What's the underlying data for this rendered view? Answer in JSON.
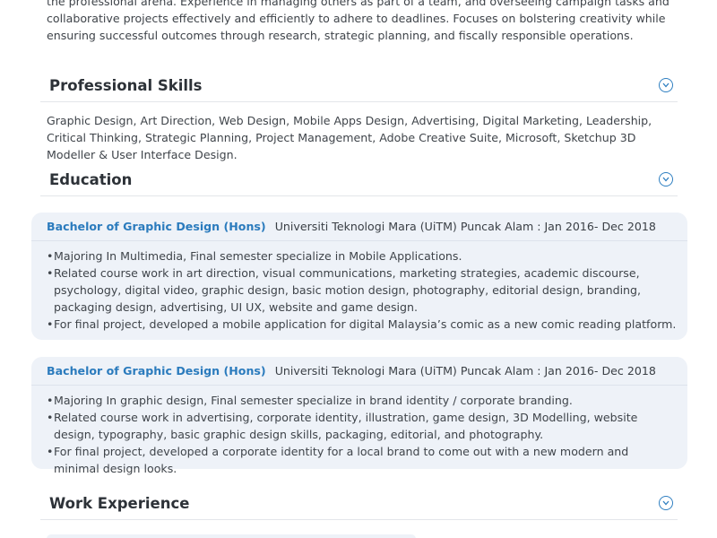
{
  "summary": {
    "text": "the professional arena. Experience in managing others as part of a team, and overseeing campaign tasks and collaborative projects effectively and efficiently to adhere to deadlines. Focuses on bolstering creativity while ensuring successful outcomes through research, strategic planning, and fiscally responsible operations."
  },
  "sections": {
    "skills": {
      "title": "Professional Skills",
      "text": "Graphic Design, Art Direction, Web Design, Mobile Apps Design, Advertising, Digital Marketing, Leadership, Critical Thinking, Strategic Planning, Project Management, Adobe Creative Suite, Microsoft, Sketchup 3D Modeller & User Interface Design."
    },
    "education": {
      "title": "Education",
      "entries": [
        {
          "degree": "Bachelor of Graphic Design (Hons)",
          "school": "Universiti Teknologi Mara (UiTM) Puncak Alam : Jan 2016- Dec 2018",
          "points": [
            "Majoring In Multimedia, Final semester specialize in Mobile Applications.",
            "Related course work in art direction, visual communications, marketing strategies, academic discourse, psychology, digital video, graphic design, basic motion design, photography, editorial design, branding, packaging design, advertising, UI UX, website and game design.",
            "For final project, developed a mobile application for digital Malaysia’s comic as a new comic reading platform."
          ]
        },
        {
          "degree": "Bachelor of Graphic Design (Hons)",
          "school": "Universiti Teknologi Mara (UiTM) Puncak Alam : Jan 2016- Dec 2018",
          "points": [
            "Majoring In graphic design, Final semester specialize in brand identity / corporate branding.",
            "Related course work in advertising, corporate identity, illustration, game design, 3D Modelling, website design, typography, basic graphic design skills, packaging, editorial, and photography.",
            "For final project, developed a corporate identity for a local brand to come out with a new modern and minimal design looks."
          ]
        }
      ]
    },
    "work": {
      "title": "Work Experience"
    }
  },
  "icons": {
    "toggle": "chevron-down-circle-icon"
  },
  "colors": {
    "accent": "#2b7bbd",
    "card_bg": "#eef2f8",
    "text": "#3f444a"
  }
}
